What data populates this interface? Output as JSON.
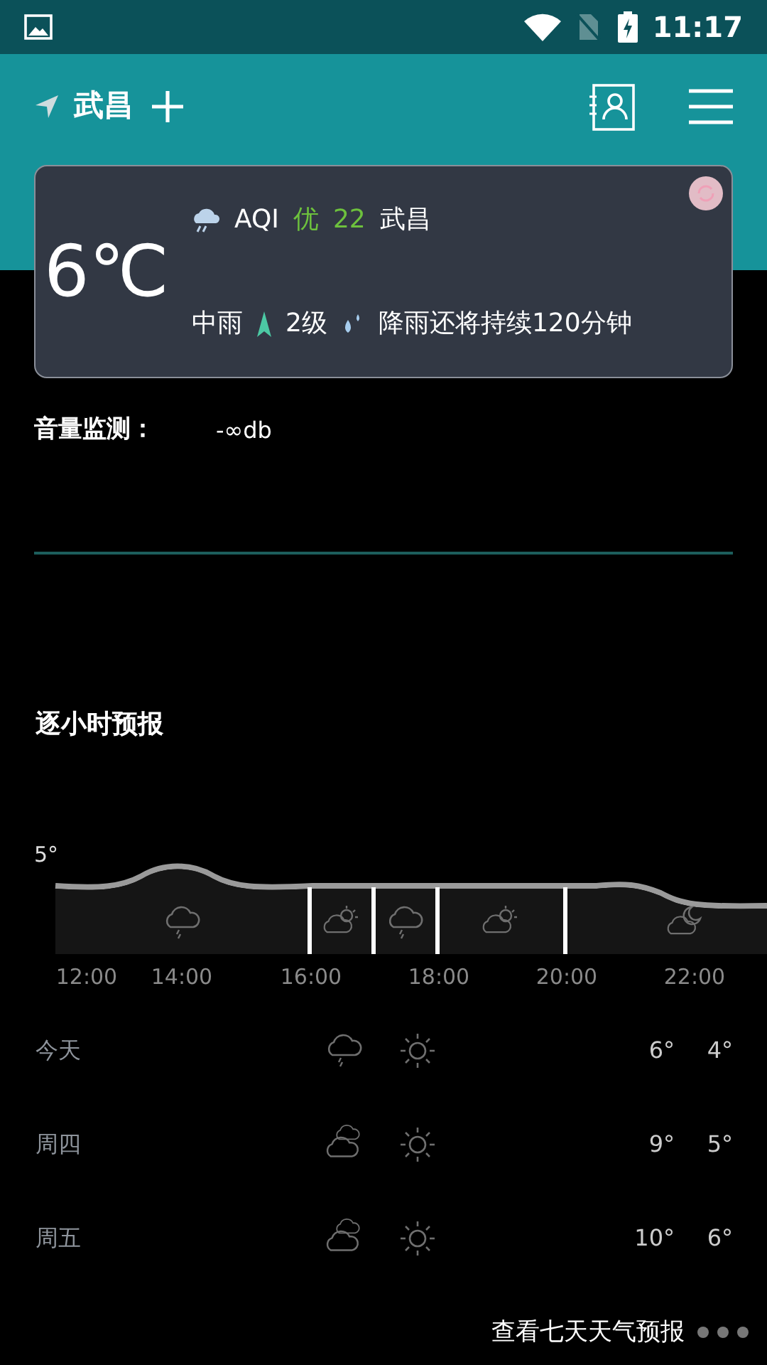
{
  "status_bar": {
    "time": "11:17"
  },
  "header": {
    "city": "武昌"
  },
  "current": {
    "temperature": "6℃",
    "aqi_label": "AQI",
    "aqi_level": "优",
    "aqi_value": "22",
    "district": "武昌",
    "condition": "中雨",
    "wind": "2级",
    "rain_note": "降雨还将持续120分钟"
  },
  "volume": {
    "label": "音量监测：",
    "value": "-∞db"
  },
  "hourly": {
    "title": "逐小时预报",
    "temp_label": "5°",
    "segments": [
      {
        "kind": "rain"
      },
      {
        "kind": "partly-day"
      },
      {
        "kind": "rain"
      },
      {
        "kind": "partly-day"
      },
      {
        "kind": "partly-night"
      }
    ],
    "times": [
      "12:00",
      "14:00",
      "16:00",
      "18:00",
      "20:00",
      "22:00"
    ]
  },
  "daily": [
    {
      "day": "今天",
      "icons": [
        {
          "kind": "rain"
        },
        {
          "kind": "sunny"
        }
      ],
      "high": "6°",
      "low": "4°"
    },
    {
      "day": "周四",
      "icons": [
        {
          "kind": "cloudy"
        },
        {
          "kind": "sunny"
        }
      ],
      "high": "9°",
      "low": "5°"
    },
    {
      "day": "周五",
      "icons": [
        {
          "kind": "cloudy"
        },
        {
          "kind": "sunny"
        }
      ],
      "high": "10°",
      "low": "6°"
    }
  ],
  "more_link": "查看七天天气预报"
}
